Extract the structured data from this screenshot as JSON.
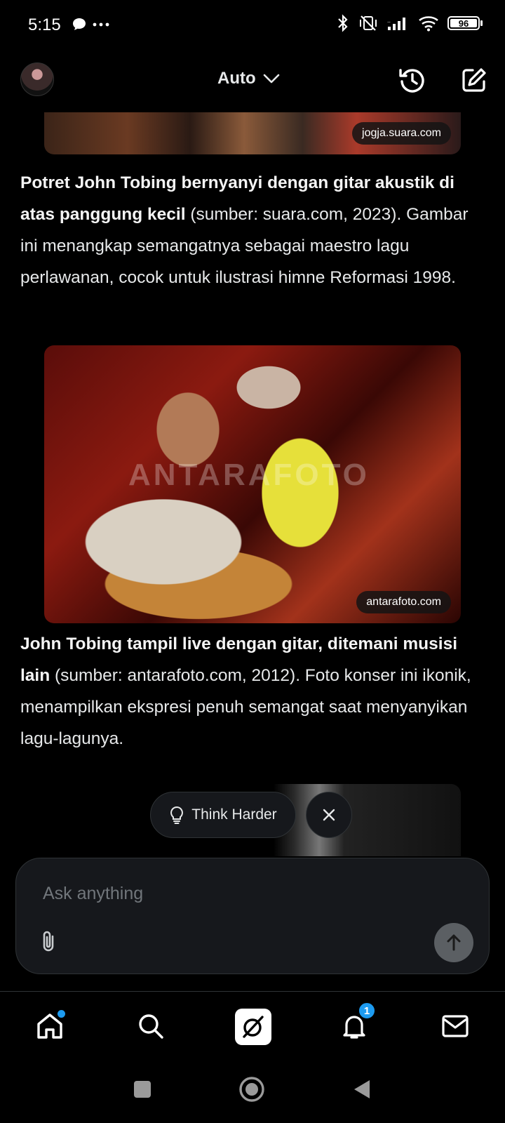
{
  "status_bar": {
    "time": "5:15",
    "battery": "96"
  },
  "header": {
    "model_label": "Auto"
  },
  "content": {
    "image1_source": "jogja.suara.com",
    "paragraph1_bold": "Potret John Tobing bernyanyi dengan gitar akustik di atas panggung kecil",
    "paragraph1_rest": " (sumber: suara.com, 2023). Gambar ini menangkap semangatnya sebagai maestro lagu perlawanan, cocok untuk ilustrasi himne Reformasi 1998.",
    "image2_watermark": "ANTARAFOTO",
    "image2_source": "antarafoto.com",
    "paragraph2_bold": "John Tobing tampil live dengan gitar, ditemani musisi lain",
    "paragraph2_rest": " (sumber: antarafoto.com, 2012). Foto konser ini ikonik, menampilkan ekspresi penuh semangat saat menyanyikan lagu-lagunya."
  },
  "suggestion": {
    "think_harder_label": "Think Harder"
  },
  "composer": {
    "placeholder": "Ask anything"
  },
  "bottom_nav": {
    "notifications_badge": "1"
  },
  "colors": {
    "accent": "#1d9bf0",
    "background": "#000000",
    "surface": "#16181c",
    "border": "#2f3336",
    "text": "#e7e9ea",
    "muted": "#71767b"
  }
}
